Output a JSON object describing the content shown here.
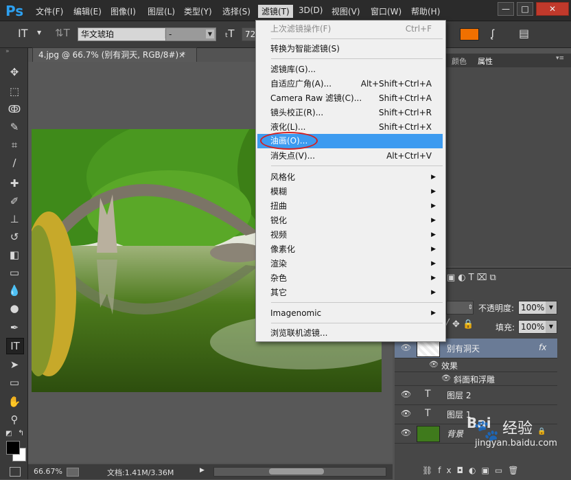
{
  "app": {
    "logo": "Ps"
  },
  "menubar": {
    "items": [
      "文件(F)",
      "编辑(E)",
      "图像(I)",
      "图层(L)",
      "类型(Y)",
      "选择(S)",
      "滤镜(T)",
      "3D(D)",
      "视图(V)",
      "窗口(W)",
      "帮助(H)"
    ],
    "active": "滤镜(T)",
    "window_buttons": [
      "—",
      "□",
      "✕"
    ]
  },
  "options_bar": {
    "font_family": "华文琥珀",
    "font_style": "-",
    "font_size": "72",
    "color_swatch": "#f07000"
  },
  "document": {
    "tab_title": "4.jpg @ 66.7% (别有洞天, RGB/8#) *",
    "tab_close": "×"
  },
  "status": {
    "zoom": "66.67%",
    "doc_size": "文档:1.41M/3.36M"
  },
  "filter_menu": {
    "items": [
      {
        "label": "上次滤镜操作(F)",
        "shortcut": "Ctrl+F",
        "disabled": true
      },
      {
        "label": "转换为智能滤镜(S)"
      },
      {
        "label": "滤镜库(G)..."
      },
      {
        "label": "自适应广角(A)...",
        "shortcut": "Alt+Shift+Ctrl+A"
      },
      {
        "label": "Camera Raw 滤镜(C)...",
        "shortcut": "Shift+Ctrl+A"
      },
      {
        "label": "镜头校正(R)...",
        "shortcut": "Shift+Ctrl+R"
      },
      {
        "label": "液化(L)...",
        "shortcut": "Shift+Ctrl+X"
      },
      {
        "label": "油画(O)...",
        "highlighted": true
      },
      {
        "label": "消失点(V)...",
        "shortcut": "Alt+Ctrl+V"
      },
      {
        "label": "风格化",
        "submenu": true
      },
      {
        "label": "模糊",
        "submenu": true
      },
      {
        "label": "扭曲",
        "submenu": true
      },
      {
        "label": "锐化",
        "submenu": true
      },
      {
        "label": "视频",
        "submenu": true
      },
      {
        "label": "像素化",
        "submenu": true
      },
      {
        "label": "渲染",
        "submenu": true
      },
      {
        "label": "杂色",
        "submenu": true
      },
      {
        "label": "其它",
        "submenu": true
      },
      {
        "label": "Imagenomic",
        "submenu": true
      },
      {
        "label": "浏览联机滤镜..."
      }
    ],
    "highlight_color": "#3d9bf0"
  },
  "panels": {
    "tabs": [
      "颜色",
      "属性"
    ],
    "active_tab": "属性"
  },
  "layers_panel": {
    "opacity_label": "不透明度:",
    "opacity_value": "100%",
    "fill_label": "填充:",
    "fill_value": "100%",
    "layers": [
      {
        "name": "别有洞天",
        "fx": "fx",
        "selected": true
      },
      {
        "name": "效果",
        "sub": true
      },
      {
        "name": "斜面和浮雕",
        "sub": true
      },
      {
        "name": "图层 2",
        "type": "text"
      },
      {
        "name": "图层 1",
        "type": "text"
      },
      {
        "name": "背景",
        "locked": true
      }
    ]
  },
  "watermark": {
    "brand": "Bai",
    "brand_cn": "经验",
    "url": "jingyan.baidu.com"
  }
}
